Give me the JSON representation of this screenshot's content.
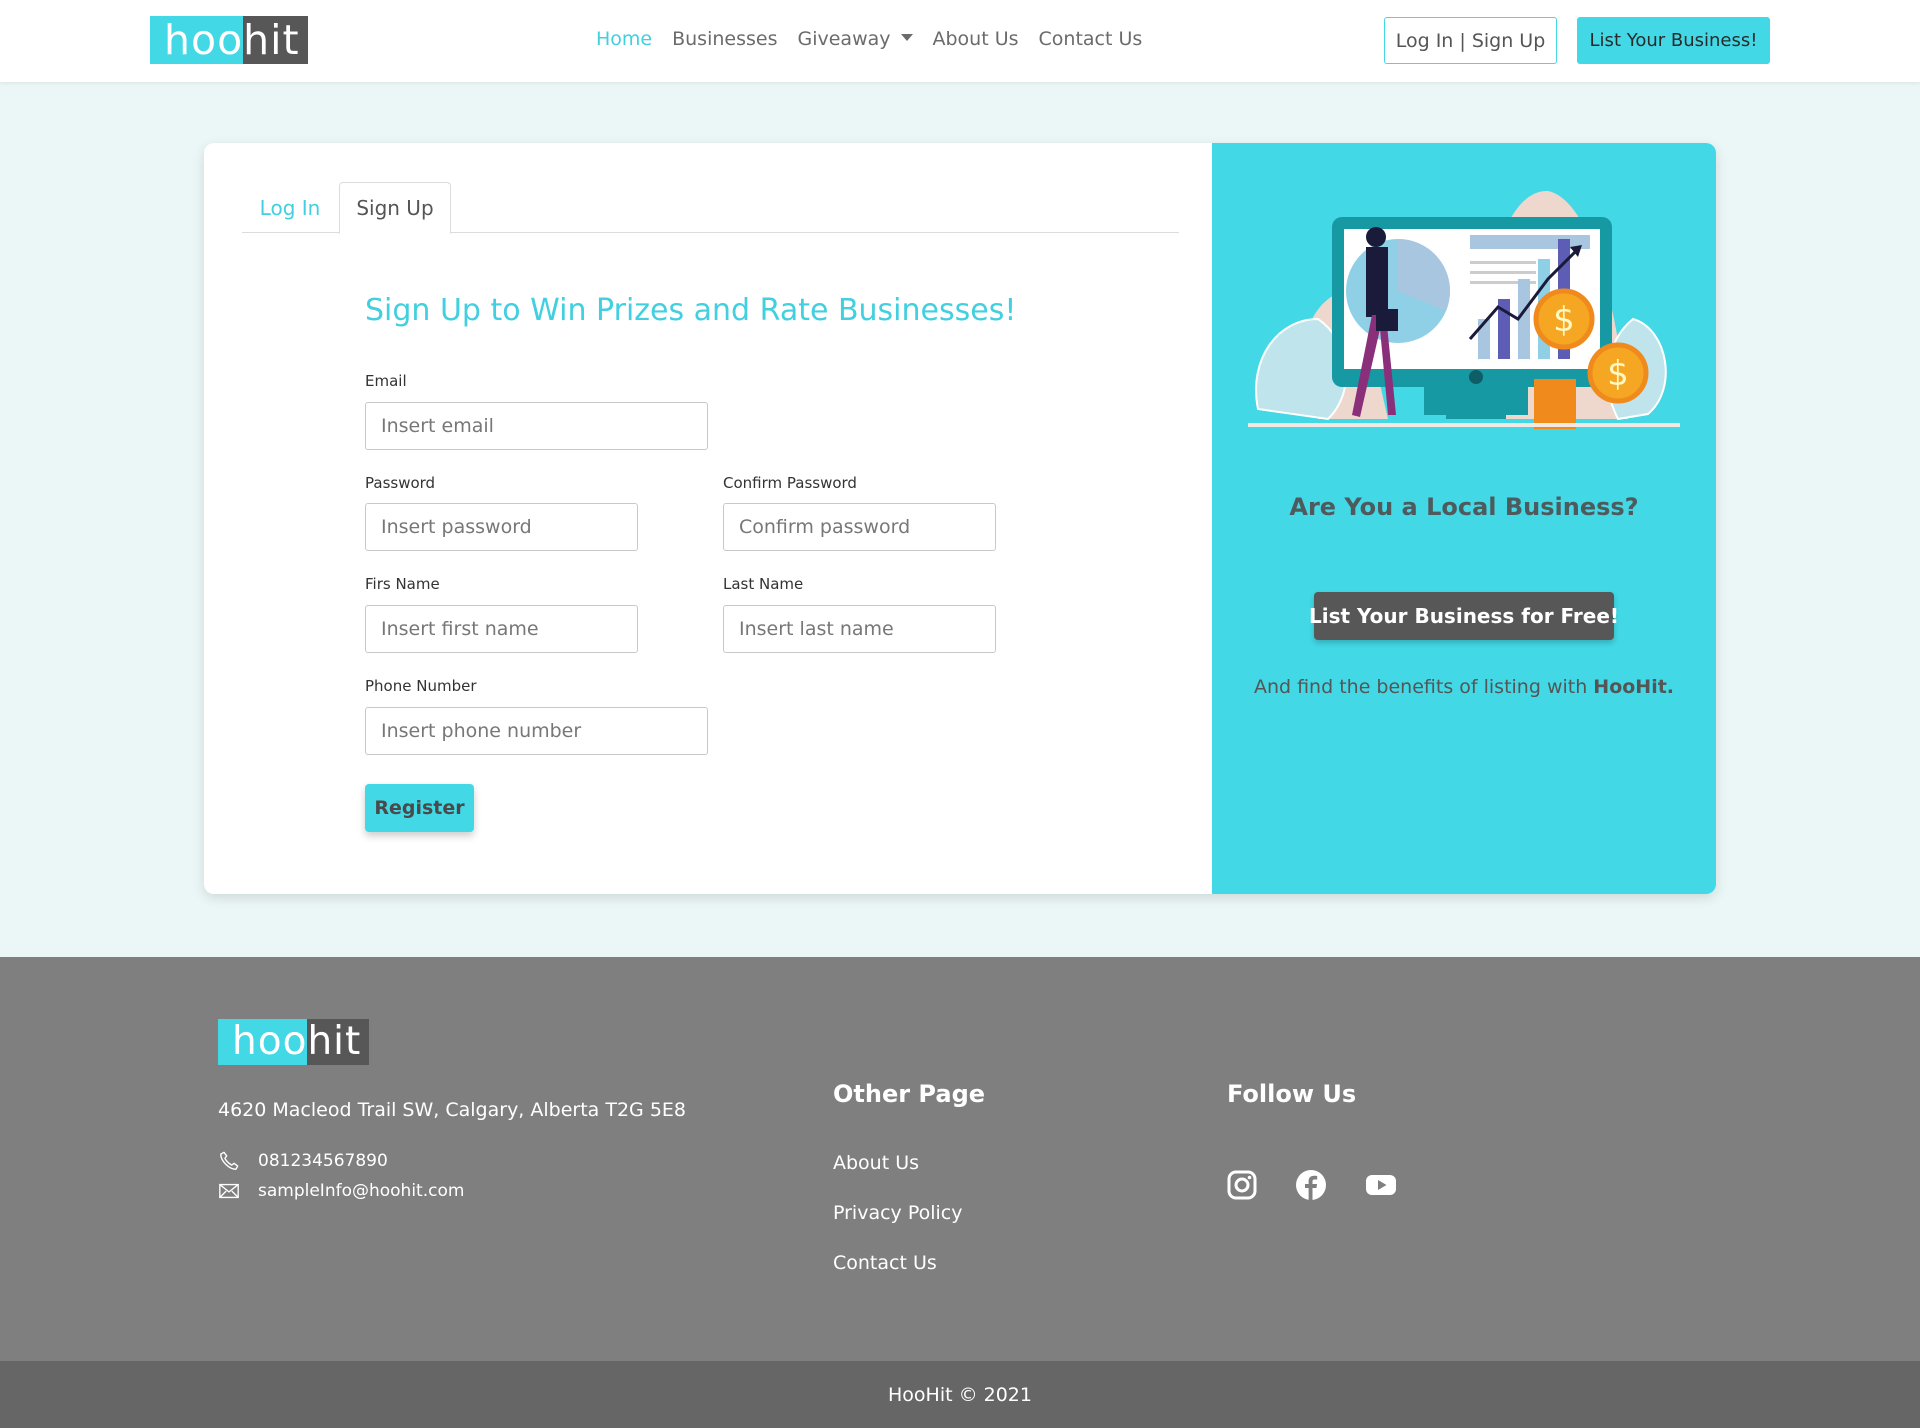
{
  "brand": {
    "logo_part1": "hoo",
    "logo_part2": "hit"
  },
  "nav": {
    "links": [
      "Home",
      "Businesses",
      "Giveaway",
      "About Us",
      "Contact Us"
    ],
    "login_label": "Log In | Sign Up",
    "list_business_label": "List Your Business!"
  },
  "tabs": {
    "login": "Log In",
    "signup": "Sign Up"
  },
  "form": {
    "title": "Sign Up to Win Prizes and Rate Businesses!",
    "email_label": "Email",
    "email_placeholder": "Insert email",
    "password_label": "Password",
    "password_placeholder": "Insert password",
    "confirm_label": "Confirm Password",
    "confirm_placeholder": "Confirm password",
    "first_label": "Firs Name",
    "first_placeholder": "Insert first name",
    "last_label": "Last Name",
    "last_placeholder": "Insert last name",
    "phone_label": "Phone Number",
    "phone_placeholder": "Insert phone number",
    "register_label": "Register"
  },
  "promo": {
    "title": "Are You a Local Business?",
    "button_label": "List Your Business for Free!",
    "text_prefix": "And find the benefits of listing with ",
    "text_brand": "HooHit."
  },
  "footer": {
    "address": "4620 Macleod Trail SW, Calgary, Alberta T2G 5E8",
    "phone": "081234567890",
    "email": "sampleInfo@hoohit.com",
    "other_title": "Other Page",
    "other_links": [
      "About Us",
      "Privacy Policy",
      "Contact Us"
    ],
    "follow_title": "Follow Us",
    "social_icons": [
      "instagram-icon",
      "facebook-icon",
      "youtube-icon"
    ],
    "copyright": "HooHit © 2021"
  },
  "colors": {
    "accent": "#42d8e6",
    "dark": "#575757",
    "footer": "#7f7f7f",
    "footer_bottom": "#666666",
    "page_bg": "#ebf7f7"
  }
}
